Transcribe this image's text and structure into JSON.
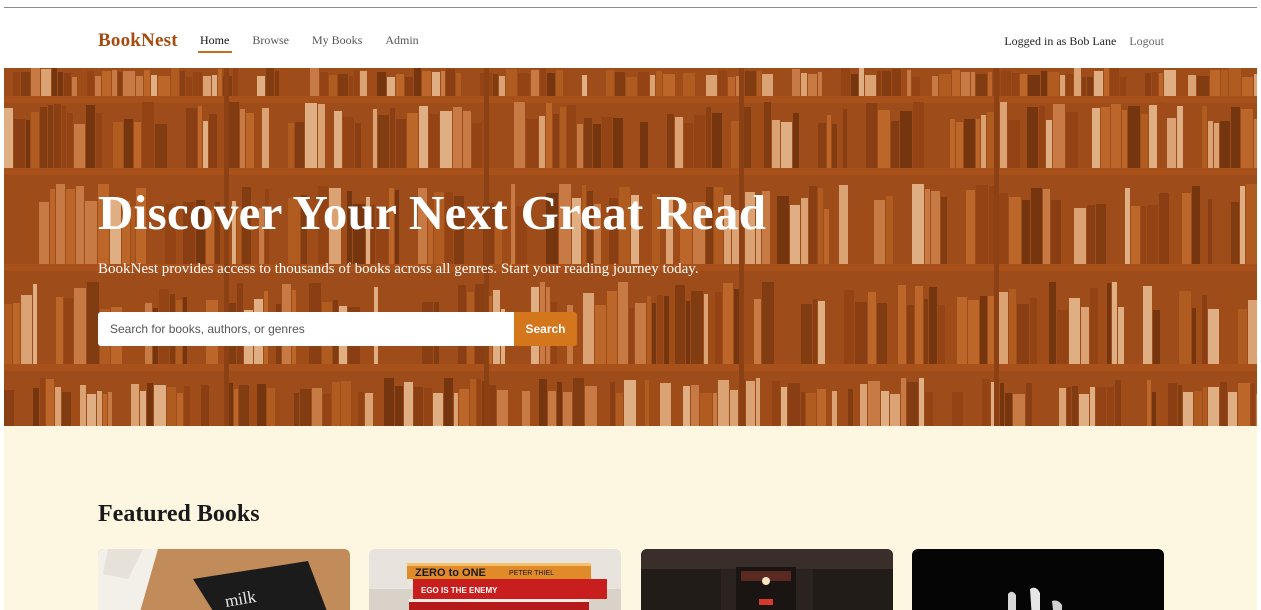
{
  "nav": {
    "brand": "BookNest",
    "links": [
      {
        "label": "Home",
        "active": true
      },
      {
        "label": "Browse",
        "active": false
      },
      {
        "label": "My Books",
        "active": false
      },
      {
        "label": "Admin",
        "active": false
      }
    ],
    "user_label": "Logged in as Bob Lane",
    "logout_label": "Logout"
  },
  "hero": {
    "title": "Discover Your Next Great Read",
    "subtitle": "BookNest provides access to thousands of books across all genres. Start your reading journey today.",
    "search_placeholder": "Search for books, authors, or genres",
    "search_button": "Search"
  },
  "featured": {
    "title": "Featured Books",
    "cards": [
      {
        "image": "book-on-wooden-table",
        "cover_text": "milk"
      },
      {
        "image": "stack-of-books",
        "spine_1": "ZERO to ONE",
        "spine_1_author": "PETER THIEL",
        "spine_2": "EGO IS THE ENEMY"
      },
      {
        "image": "library-corridor"
      },
      {
        "image": "dark-book-pages"
      }
    ]
  },
  "colors": {
    "brand": "#a64b10",
    "accent": "#d4761c",
    "hero_tint": "#b0571e",
    "section_bg": "#fdf6e0"
  }
}
